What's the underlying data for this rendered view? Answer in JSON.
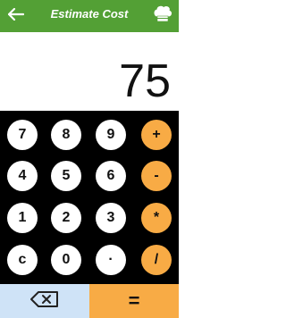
{
  "header": {
    "title": "Estimate Cost",
    "back_icon": "arrow-left-icon",
    "chef_icon": "chef-hat-icon",
    "bar_color": "#53a035"
  },
  "display": {
    "value": "75"
  },
  "keypad": {
    "digit_color": "#ffffff",
    "operator_color": "#f8ab45",
    "background": "#000000",
    "row1": [
      "7",
      "8",
      "9",
      "+"
    ],
    "row2": [
      "4",
      "5",
      "6",
      "-"
    ],
    "row3": [
      "1",
      "2",
      "3",
      "*"
    ],
    "row4": [
      "c",
      "0",
      "·",
      "/"
    ]
  },
  "bottom": {
    "backspace_icon": "backspace-icon",
    "equals_label": "=",
    "backspace_color": "#cfe3f7",
    "equals_color": "#f8ab45"
  }
}
